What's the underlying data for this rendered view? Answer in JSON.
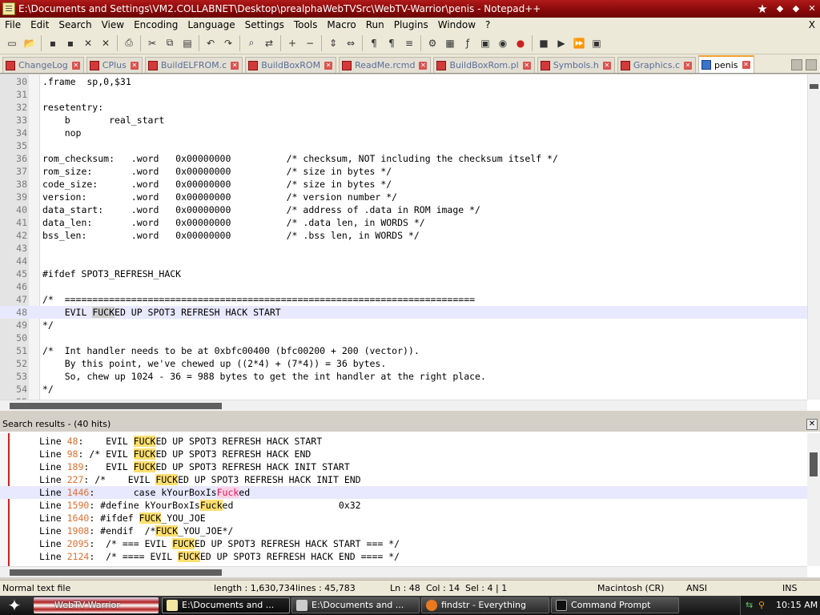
{
  "window": {
    "title": "E:\\Documents and Settings\\VM2.COLLABNET\\Desktop\\prealphaWebTVSrc\\WebTV-Warrior\\penis - Notepad++",
    "controls": [
      "★",
      "◆",
      "◆",
      "✕"
    ]
  },
  "menu": [
    "File",
    "Edit",
    "Search",
    "View",
    "Encoding",
    "Language",
    "Settings",
    "Tools",
    "Macro",
    "Run",
    "Plugins",
    "Window",
    "?"
  ],
  "menu_close": "X",
  "toolbar_icons": [
    "new-file-icon",
    "open-file-icon",
    "save-icon",
    "save-all-icon",
    "close-icon",
    "close-all-icon",
    "print-icon",
    "cut-icon",
    "copy-icon",
    "paste-icon",
    "undo-icon",
    "redo-icon",
    "find-icon",
    "replace-icon",
    "zoom-in-icon",
    "zoom-out-icon",
    "sync-v-icon",
    "sync-h-icon",
    "word-wrap-icon",
    "show-all-chars-icon",
    "indent-guide-icon",
    "user-lang-icon",
    "doc-map-icon",
    "function-list-icon",
    "folder-workspace-icon",
    "monitor-icon",
    "record-macro-icon",
    "stop-record-icon",
    "play-macro-icon",
    "play-multiple-icon",
    "save-macro-icon"
  ],
  "tabs": [
    {
      "label": "ChangeLog",
      "active": false
    },
    {
      "label": "CPlus",
      "active": false
    },
    {
      "label": "BuildELFROM.c",
      "active": false
    },
    {
      "label": "BuildBoxROM",
      "active": false
    },
    {
      "label": "ReadMe.rcmd",
      "active": false
    },
    {
      "label": "BuildBoxRom.pl",
      "active": false
    },
    {
      "label": "Symbols.h",
      "active": false
    },
    {
      "label": "Graphics.c",
      "active": false
    },
    {
      "label": "penis",
      "active": true
    }
  ],
  "editor": {
    "lines": [
      {
        "n": "30",
        "text": ".frame  sp,0,$31"
      },
      {
        "n": "31",
        "text": ""
      },
      {
        "n": "32",
        "text": "resetentry:"
      },
      {
        "n": "33",
        "text": "    b       real_start"
      },
      {
        "n": "34",
        "text": "    nop"
      },
      {
        "n": "35",
        "text": ""
      },
      {
        "n": "36",
        "text": "rom_checksum:   .word   0x00000000          /* checksum, NOT including the checksum itself */"
      },
      {
        "n": "37",
        "text": "rom_size:       .word   0x00000000          /* size in bytes */"
      },
      {
        "n": "38",
        "text": "code_size:      .word   0x00000000          /* size in bytes */"
      },
      {
        "n": "39",
        "text": "version:        .word   0x00000000          /* version number */"
      },
      {
        "n": "40",
        "text": "data_start:     .word   0x00000000          /* address of .data in ROM image */"
      },
      {
        "n": "41",
        "text": "data_len:       .word   0x00000000          /* .data len, in WORDS */"
      },
      {
        "n": "42",
        "text": "bss_len:        .word   0x00000000          /* .bss len, in WORDS */"
      },
      {
        "n": "43",
        "text": ""
      },
      {
        "n": "44",
        "text": ""
      },
      {
        "n": "45",
        "text": "#ifdef SPOT3_REFRESH_HACK"
      },
      {
        "n": "46",
        "text": ""
      },
      {
        "n": "47",
        "text": "/*  =========================================================================="
      },
      {
        "n": "48",
        "text": "    EVIL FUCKED UP SPOT3 REFRESH HACK START",
        "current": true
      },
      {
        "n": "49",
        "text": "*/"
      },
      {
        "n": "50",
        "text": ""
      },
      {
        "n": "51",
        "text": "/*  Int handler needs to be at 0xbfc00400 (bfc00200 + 200 (vector))."
      },
      {
        "n": "52",
        "text": "    By this point, we've chewed up ((2*4) + (7*4)) = 36 bytes."
      },
      {
        "n": "53",
        "text": "    So, chew up 1024 - 36 = 988 bytes to get the int handler at the right place."
      },
      {
        "n": "54",
        "text": "*/"
      },
      {
        "n": "55",
        "text": ""
      }
    ]
  },
  "search": {
    "header": "Search results - (40 hits)",
    "results": [
      {
        "line": "48",
        "pre": ":    EVIL ",
        "hit": "FUCK",
        "post": "ED UP SPOT3 REFRESH HACK START"
      },
      {
        "line": "98",
        "pre": ": /* EVIL ",
        "hit": "FUCK",
        "post": "ED UP SPOT3 REFRESH HACK END"
      },
      {
        "line": "189",
        "pre": ":   EVIL ",
        "hit": "FUCK",
        "post": "ED UP SPOT3 REFRESH HACK INIT START"
      },
      {
        "line": "227",
        "pre": ": /*    EVIL ",
        "hit": "FUCK",
        "post": "ED UP SPOT3 REFRESH HACK INIT END"
      },
      {
        "line": "1446",
        "pre": ":       case kYourBoxIs",
        "hit": "Fuck",
        "post": "ed",
        "current": true,
        "pink": true
      },
      {
        "line": "1590",
        "pre": ": #define kYourBoxIs",
        "hit": "Fuck",
        "post": "ed                   0x32"
      },
      {
        "line": "1640",
        "pre": ": #ifdef ",
        "hit": "FUCK",
        "post": "_YOU_JOE"
      },
      {
        "line": "1908",
        "pre": ": #endif  /*",
        "hit": "FUCK",
        "post": "_YOU_JOE*/"
      },
      {
        "line": "2095",
        "pre": ":  /* === EVIL ",
        "hit": "FUCK",
        "post": "ED UP SPOT3 REFRESH HACK START === */"
      },
      {
        "line": "2124",
        "pre": ":  /* ==== EVIL ",
        "hit": "FUCK",
        "post": "ED UP SPOT3 REFRESH HACK END ==== */"
      }
    ]
  },
  "status": {
    "type": "Normal text file",
    "length": "length : 1,630,734",
    "lines": "lines : 45,783",
    "ln": "Ln : 48",
    "col": "Col : 14",
    "sel": "Sel : 4 | 1",
    "eol": "Macintosh (CR)",
    "encoding": "ANSI",
    "mode": "INS"
  },
  "taskbar": {
    "start_label": "✦",
    "buttons": [
      {
        "label": "WebTV Warrior",
        "icon": "flag-icon"
      },
      {
        "label": "E:\\Documents and ...",
        "icon": "notepad-icon",
        "active": true
      },
      {
        "label": "E:\\Documents and ...",
        "icon": "console-icon"
      },
      {
        "label": "findstr - Everything",
        "icon": "search-icon"
      },
      {
        "label": "Command Prompt",
        "icon": "cmd-icon"
      }
    ],
    "clock": "10:15 AM"
  },
  "colors": {
    "title_gradient": "#8a0a0a",
    "hit_yellow": "#ffe070",
    "line_number_orange": "#e07030",
    "current_line": "#e8e8ff"
  }
}
